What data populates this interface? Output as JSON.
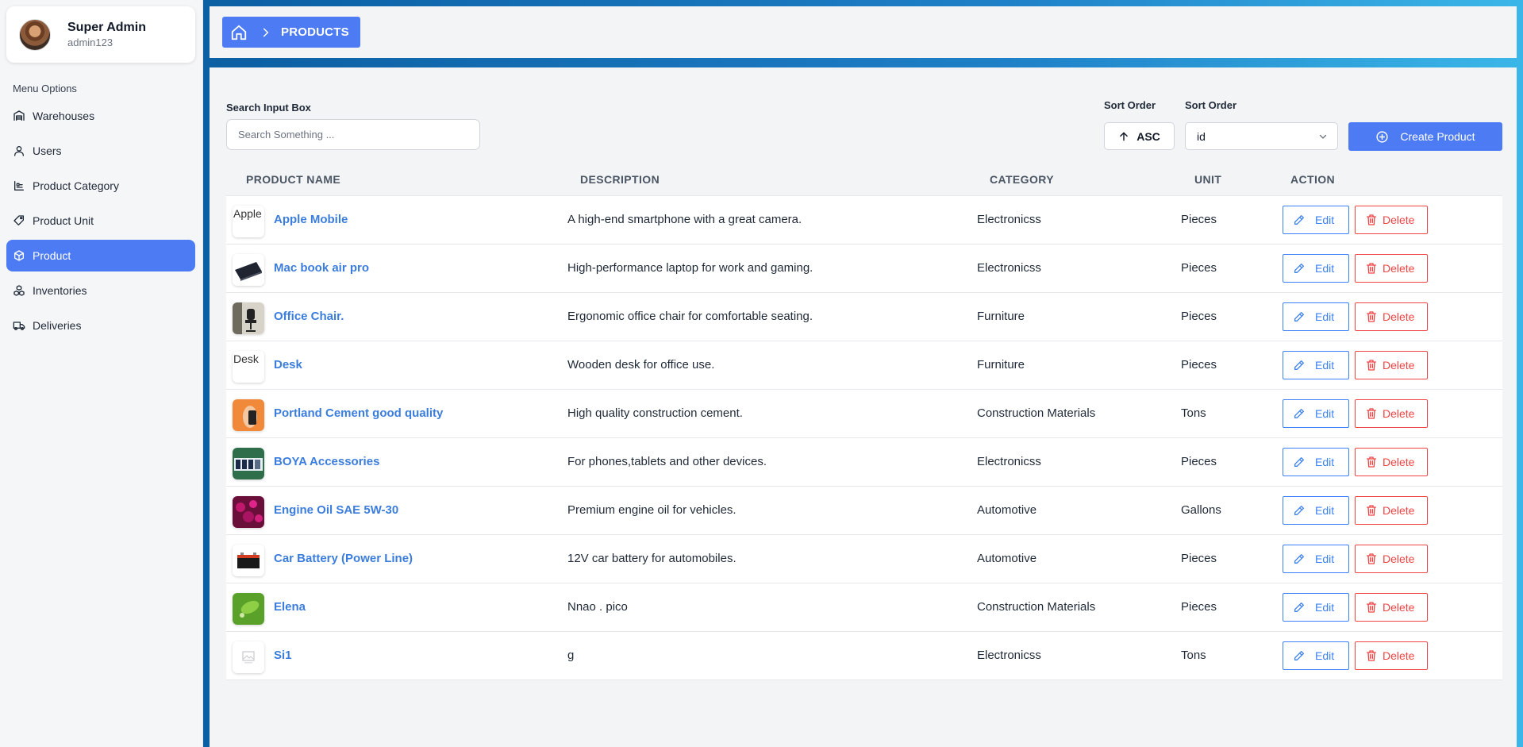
{
  "profile": {
    "name": "Super Admin",
    "username": "admin123"
  },
  "sidebar": {
    "title": "Menu Options",
    "items": [
      {
        "label": "Warehouses",
        "icon": "warehouse-icon",
        "active": false
      },
      {
        "label": "Users",
        "icon": "user-icon",
        "active": false
      },
      {
        "label": "Product Category",
        "icon": "category-icon",
        "active": false
      },
      {
        "label": "Product Unit",
        "icon": "tag-icon",
        "active": false
      },
      {
        "label": "Product",
        "icon": "box-icon",
        "active": true
      },
      {
        "label": "Inventories",
        "icon": "boxes-icon",
        "active": false
      },
      {
        "label": "Deliveries",
        "icon": "truck-icon",
        "active": false
      }
    ]
  },
  "breadcrumb": {
    "current": "PRODUCTS"
  },
  "search": {
    "label": "Search Input Box",
    "placeholder": "Search Something ..."
  },
  "sort": {
    "direction_label": "Sort Order",
    "direction_value": "ASC",
    "field_label": "Sort Order",
    "field_value": "id"
  },
  "create_button": "Create Product",
  "table": {
    "columns": [
      "PRODUCT NAME",
      "DESCRIPTION",
      "CATEGORY",
      "UNIT",
      "ACTION"
    ],
    "edit_label": "Edit",
    "delete_label": "Delete",
    "rows": [
      {
        "name": "Apple Mobile",
        "description": "A high-end smartphone with a great camera.",
        "category": "Electronicss",
        "unit": "Pieces",
        "thumb": "broken",
        "alt": "Apple Mobile"
      },
      {
        "name": "Mac book air pro",
        "description": "High-performance laptop for work and gaming.",
        "category": "Electronicss",
        "unit": "Pieces",
        "thumb": "laptop"
      },
      {
        "name": "Office Chair.",
        "description": "Ergonomic office chair for comfortable seating.",
        "category": "Furniture",
        "unit": "Pieces",
        "thumb": "chair"
      },
      {
        "name": "Desk",
        "description": "Wooden desk for office use.",
        "category": "Furniture",
        "unit": "Pieces",
        "thumb": "broken",
        "alt": "Desk"
      },
      {
        "name": "Portland Cement good quality",
        "description": "High quality construction cement.",
        "category": "Construction Materials",
        "unit": "Tons",
        "thumb": "cement"
      },
      {
        "name": "BOYA Accessories",
        "description": "For phones,tablets and other devices.",
        "category": "Electronicss",
        "unit": "Pieces",
        "thumb": "accessories"
      },
      {
        "name": "Engine Oil SAE 5W-30",
        "description": "Premium engine oil for vehicles.",
        "category": "Automotive",
        "unit": "Gallons",
        "thumb": "oil"
      },
      {
        "name": "Car Battery (Power Line)",
        "description": "12V car battery for automobiles.",
        "category": "Automotive",
        "unit": "Pieces",
        "thumb": "battery"
      },
      {
        "name": "Elena",
        "description": "Nnao . pico",
        "category": "Construction Materials",
        "unit": "Pieces",
        "thumb": "leaf"
      },
      {
        "name": "Si1",
        "description": "g",
        "category": "Electronicss",
        "unit": "Tons",
        "thumb": "placeholder"
      }
    ]
  },
  "colors": {
    "accent": "#4d7bf3",
    "link": "#3b7ddd",
    "danger": "#ef4444",
    "edit": "#3b82f6"
  }
}
